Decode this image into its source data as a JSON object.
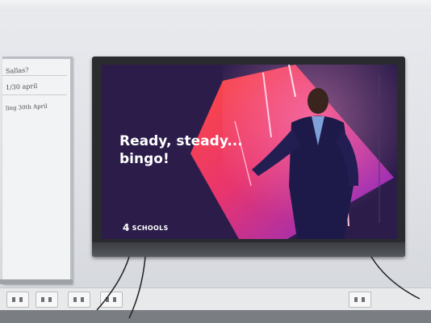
{
  "whiteboard": {
    "notes": [
      "Sallas?",
      "1/30 april",
      "ling 30th April"
    ]
  },
  "screen": {
    "headline_line1": "Ready, steady...",
    "headline_line2": "bingo!",
    "brand_mark": "4",
    "brand_name": "SCHOOLS",
    "background_color": "#2b1c4a",
    "accent_colors": [
      "#e8356e",
      "#8a2be2",
      "#ff5a3c"
    ]
  }
}
